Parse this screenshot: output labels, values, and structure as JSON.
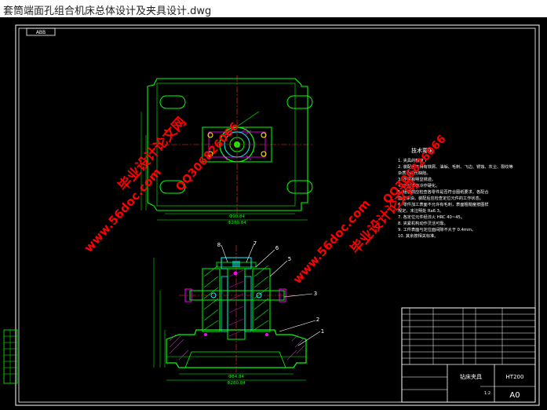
{
  "window": {
    "title": "套筒端面孔组合机床总体设计及夹具设计.dwg"
  },
  "drawing": {
    "colors": {
      "background": "#000000",
      "frame": "#ffffff",
      "outline": "#00ff00",
      "centerline": "#ff3030",
      "hatch": "#ff00ff",
      "section": "#00ffff",
      "watermark": "#ff0000",
      "dimension": "#00ff00"
    },
    "top_tab_label": "ABB",
    "balloons": [
      "8",
      "7",
      "6",
      "5",
      "3",
      "2",
      "1"
    ],
    "tech_req": {
      "heading": "技术要求",
      "lines": [
        "1. 夹具的精度 T",
        "2. 装配上不得有铁屑、油垢、毛刺、飞边、锈蚀、灰尘、裂纹等",
        "   杂质及损伤缺陷。",
        "3. 不得有明显锈迹。",
        "4. 不允许有冷作硬化。",
        "5. 组装前应检查各零件是否符合图纸要求，各配合",
        "   面应涂油，装配后应检查定位元件的工作状态。",
        "6. 零件加工表面不允许有毛刺，表面粗糙度按图样",
        "   规定，未注明处 Ra6.3。",
        "7. 各定位元件经淬火 HRC 40~45。",
        "8. 夹紧机构动作灵活可靠。",
        "9. 工件表面与定位面间隙不大于 0.4mm。",
        "10. 其余按相关标准。"
      ]
    },
    "dimensions": {
      "top_view_width_1": "Φ90.84",
      "top_view_width_2": "Φ280.84",
      "front_view_width_1": "Φ84.84",
      "front_view_width_2": "Φ280.84"
    },
    "title_block": {
      "drawing_name": "钻床夹具",
      "material": "HT200",
      "scale": "1:2",
      "sheet_size": "A0"
    },
    "watermarks": {
      "brand_1": "毕业设计论文网",
      "phone_1": "QQ306826066",
      "url_1": "www.56doc.com",
      "brand_2": "毕业设计论文网",
      "phone_2": "QQ306826066",
      "url_2": "www.56doc.com"
    }
  }
}
